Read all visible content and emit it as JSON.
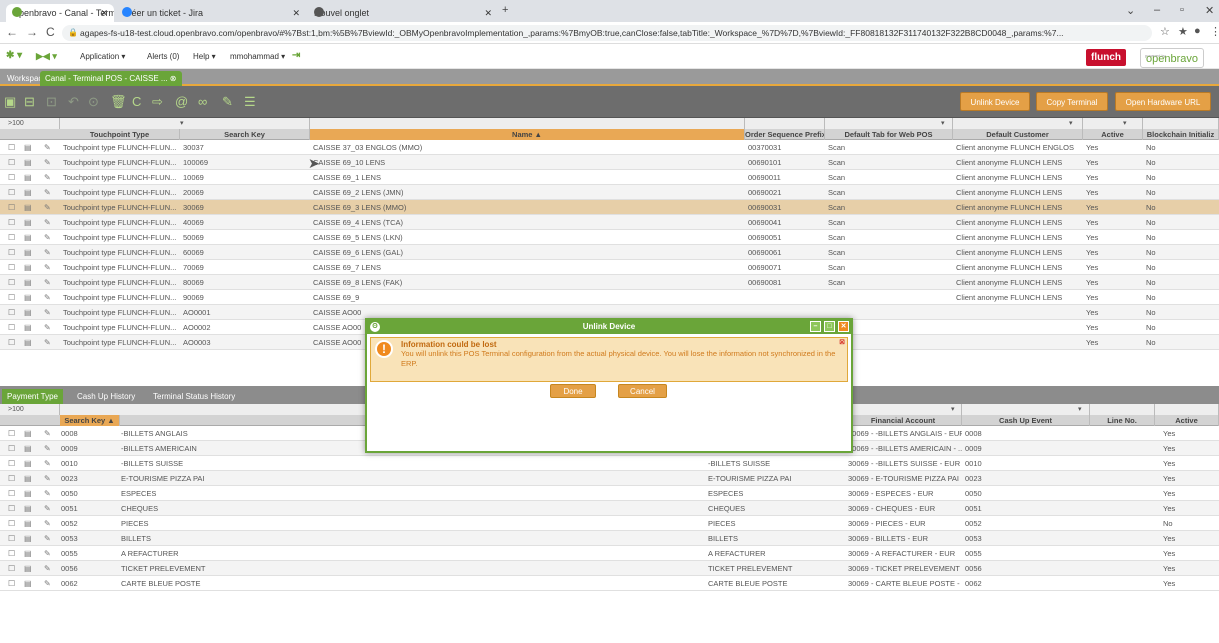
{
  "browser": {
    "tabs": [
      {
        "title": "Openbravo - Canal - Terminal PO",
        "icon": "openbravo-icon"
      },
      {
        "title": "Créer un ticket - Jira",
        "icon": "jira-icon"
      },
      {
        "title": "Nouvel onglet",
        "icon": "chrome-icon"
      }
    ],
    "url": "agapes-fs-u18-test.cloud.openbravo.com/openbravo/#%7Bst:1,bm:%5B%7BviewId:_OBMyOpenbravoImplementation_,params:%7BmyOB:true,canClose:false,tabTitle:_Workspace_%7D%7D,%7BviewId:_FF80818132F311740132F322B8CD0048_,params:%7..."
  },
  "menu": {
    "application": "Application",
    "alerts": "Alerts (0)",
    "help": "Help",
    "user": "mmohammad",
    "brand": "flunch",
    "logo_caption": "powered by",
    "logo": "openbravo"
  },
  "workspace": {
    "tabs": [
      "Workspace",
      "Canal - Terminal POS - CAISSE ..."
    ]
  },
  "toolbar": {
    "unlink": "Unlink Device",
    "copy": "Copy Terminal",
    "open_hw": "Open Hardware URL"
  },
  "grid": {
    "count": ">100",
    "headers": [
      "Touchpoint Type",
      "Search Key",
      "Name ▲",
      "Order Sequence Prefix",
      "Default Tab for Web POS",
      "Default Customer",
      "Active",
      "Blockchain Initializ"
    ],
    "rows": [
      {
        "type": "Touchpoint type FLUNCH-FLUN...",
        "key": "30037",
        "name": "CAISSE 37_03 ENGLOS (MMO)",
        "prefix": "00370031",
        "tab": "Scan",
        "cust": "Client anonyme FLUNCH ENGLOS",
        "active": "Yes",
        "bc": "No"
      },
      {
        "type": "Touchpoint type FLUNCH-FLUN...",
        "key": "100069",
        "name": "CAISSE 69_10 LENS",
        "prefix": "00690101",
        "tab": "Scan",
        "cust": "Client anonyme FLUNCH LENS",
        "active": "Yes",
        "bc": "No"
      },
      {
        "type": "Touchpoint type FLUNCH-FLUN...",
        "key": "10069",
        "name": "CAISSE 69_1 LENS",
        "prefix": "00690011",
        "tab": "Scan",
        "cust": "Client anonyme FLUNCH LENS",
        "active": "Yes",
        "bc": "No"
      },
      {
        "type": "Touchpoint type FLUNCH-FLUN...",
        "key": "20069",
        "name": "CAISSE 69_2 LENS (JMN)",
        "prefix": "00690021",
        "tab": "Scan",
        "cust": "Client anonyme FLUNCH LENS",
        "active": "Yes",
        "bc": "No"
      },
      {
        "type": "Touchpoint type FLUNCH-FLUN...",
        "key": "30069",
        "name": "CAISSE 69_3 LENS (MMO)",
        "prefix": "00690031",
        "tab": "Scan",
        "cust": "Client anonyme FLUNCH LENS",
        "active": "Yes",
        "bc": "No"
      },
      {
        "type": "Touchpoint type FLUNCH-FLUN...",
        "key": "40069",
        "name": "CAISSE 69_4 LENS (TCA)",
        "prefix": "00690041",
        "tab": "Scan",
        "cust": "Client anonyme FLUNCH LENS",
        "active": "Yes",
        "bc": "No"
      },
      {
        "type": "Touchpoint type FLUNCH-FLUN...",
        "key": "50069",
        "name": "CAISSE 69_5 LENS (LKN)",
        "prefix": "00690051",
        "tab": "Scan",
        "cust": "Client anonyme FLUNCH LENS",
        "active": "Yes",
        "bc": "No"
      },
      {
        "type": "Touchpoint type FLUNCH-FLUN...",
        "key": "60069",
        "name": "CAISSE 69_6 LENS (GAL)",
        "prefix": "00690061",
        "tab": "Scan",
        "cust": "Client anonyme FLUNCH LENS",
        "active": "Yes",
        "bc": "No"
      },
      {
        "type": "Touchpoint type FLUNCH-FLUN...",
        "key": "70069",
        "name": "CAISSE 69_7 LENS",
        "prefix": "00690071",
        "tab": "Scan",
        "cust": "Client anonyme FLUNCH LENS",
        "active": "Yes",
        "bc": "No"
      },
      {
        "type": "Touchpoint type FLUNCH-FLUN...",
        "key": "80069",
        "name": "CAISSE 69_8 LENS (FAK)",
        "prefix": "00690081",
        "tab": "Scan",
        "cust": "Client anonyme FLUNCH LENS",
        "active": "Yes",
        "bc": "No"
      },
      {
        "type": "Touchpoint type FLUNCH-FLUN...",
        "key": "90069",
        "name": "CAISSE 69_9",
        "prefix": "",
        "tab": "",
        "cust": "Client anonyme FLUNCH LENS",
        "active": "Yes",
        "bc": "No"
      },
      {
        "type": "Touchpoint type FLUNCH-FLUN...",
        "key": "AO0001",
        "name": "CAISSE AO00",
        "prefix": "",
        "tab": "",
        "cust": "",
        "active": "Yes",
        "bc": "No"
      },
      {
        "type": "Touchpoint type FLUNCH-FLUN...",
        "key": "AO0002",
        "name": "CAISSE AO00",
        "prefix": "",
        "tab": "",
        "cust": "",
        "active": "Yes",
        "bc": "No"
      },
      {
        "type": "Touchpoint type FLUNCH-FLUN...",
        "key": "AO0003",
        "name": "CAISSE AO00",
        "prefix": "",
        "tab": "",
        "cust": "",
        "active": "Yes",
        "bc": "No"
      }
    ]
  },
  "subtabs": [
    "Payment Type",
    "Cash Up History",
    "Terminal Status History"
  ],
  "grid2": {
    "count": ">100",
    "headers": [
      "Search Key ▲",
      "Financial Account",
      "Cash Up Event",
      "Line No.",
      "Active"
    ],
    "rows": [
      {
        "key": "0008",
        "name": "-BILLETS ANGLAIS",
        "name2": "-BILLETS ANGLAIS",
        "fa": "30069 - -BILLETS ANGLAIS - EUR",
        "ev": "0008",
        "active": "Yes"
      },
      {
        "key": "0009",
        "name": "-BILLETS AMERICAIN",
        "name2": "-BILLETS AMERICAIN",
        "fa": "30069 - -BILLETS AMERICAIN - ...",
        "ev": "0009",
        "active": "Yes"
      },
      {
        "key": "0010",
        "name": "-BILLETS SUISSE",
        "name2": "-BILLETS SUISSE",
        "fa": "30069 - -BILLETS SUISSE - EUR",
        "ev": "0010",
        "active": "Yes"
      },
      {
        "key": "0023",
        "name": "E-TOURISME PIZZA PAI",
        "name2": "E-TOURISME PIZZA PAI",
        "fa": "30069 - E-TOURISME PIZZA PAI",
        "ev": "0023",
        "active": "Yes"
      },
      {
        "key": "0050",
        "name": "ESPECES",
        "name2": "ESPECES",
        "fa": "30069 - ESPECES - EUR",
        "ev": "0050",
        "active": "Yes"
      },
      {
        "key": "0051",
        "name": "CHEQUES",
        "name2": "CHEQUES",
        "fa": "30069 - CHEQUES - EUR",
        "ev": "0051",
        "active": "Yes"
      },
      {
        "key": "0052",
        "name": "PIECES",
        "name2": "PIECES",
        "fa": "30069 - PIECES - EUR",
        "ev": "0052",
        "active": "No"
      },
      {
        "key": "0053",
        "name": "BILLETS",
        "name2": "BILLETS",
        "fa": "30069 - BILLETS - EUR",
        "ev": "0053",
        "active": "Yes"
      },
      {
        "key": "0055",
        "name": "A REFACTURER",
        "name2": "A REFACTURER",
        "fa": "30069 - A REFACTURER - EUR",
        "ev": "0055",
        "active": "Yes"
      },
      {
        "key": "0056",
        "name": "TICKET PRELEVEMENT",
        "name2": "TICKET PRELEVEMENT",
        "fa": "30069 - TICKET PRELEVEMENT",
        "ev": "0056",
        "active": "Yes"
      },
      {
        "key": "0062",
        "name": "CARTE BLEUE POSTE",
        "name2": "CARTE BLEUE POSTE",
        "fa": "30069 - CARTE BLEUE POSTE - ...",
        "ev": "0062",
        "active": "Yes"
      }
    ]
  },
  "dialog": {
    "title": "Unlink Device",
    "msg_title": "Information could be lost",
    "msg_text": "You will unlink this POS Terminal configuration from the actual physical device. You will lose the information not synchronized in the ERP.",
    "done": "Done",
    "cancel": "Cancel"
  }
}
